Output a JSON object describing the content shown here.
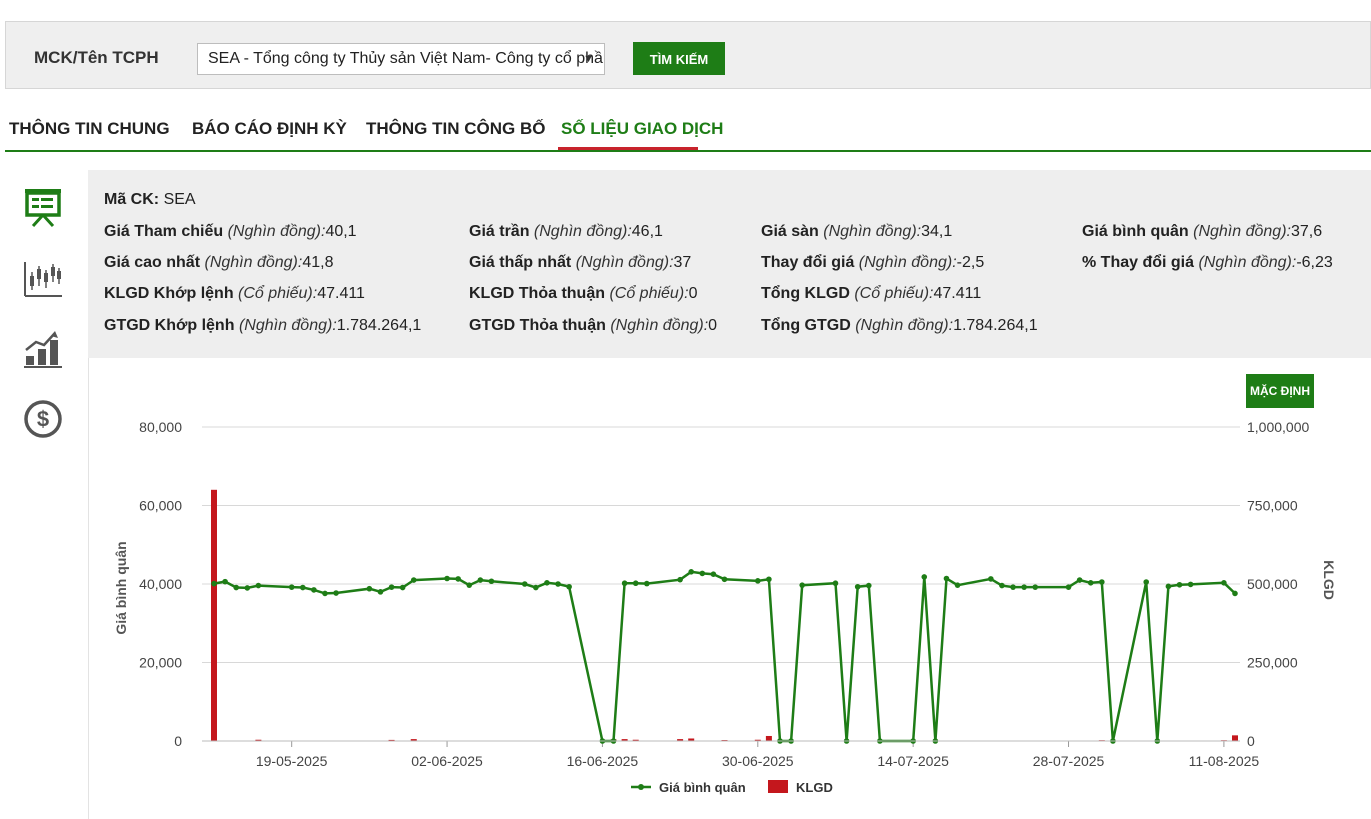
{
  "search": {
    "label": "MCK/Tên TCPH",
    "selected": "SEA - Tổng công ty Thủy sản Việt Nam- Công ty cổ phần",
    "button": "TÌM KIẾM"
  },
  "tabs": [
    {
      "label": "THÔNG TIN CHUNG"
    },
    {
      "label": "BÁO CÁO ĐỊNH KỲ"
    },
    {
      "label": "THÔNG TIN CÔNG BỐ"
    },
    {
      "label": "SỐ LIỆU GIAO DỊCH"
    }
  ],
  "sidebar": {
    "icons": [
      "presentation-icon",
      "candlestick-chart-icon",
      "growth-chart-icon",
      "dollar-coin-icon"
    ],
    "accent": "#1e7d16"
  },
  "info": {
    "ma_ck": {
      "label": "Mã CK:",
      "value": "SEA"
    },
    "fields": [
      {
        "label": "Giá Tham chiếu",
        "unit": "(Nghìn đồng):",
        "value": "40,1"
      },
      {
        "label": "Giá trần",
        "unit": "(Nghìn đồng):",
        "value": "46,1"
      },
      {
        "label": "Giá sàn",
        "unit": "(Nghìn đồng):",
        "value": "34,1"
      },
      {
        "label": "Giá bình quân",
        "unit": "(Nghìn đồng):",
        "value": "37,6"
      },
      {
        "label": "Giá cao nhất",
        "unit": "(Nghìn đồng):",
        "value": "41,8"
      },
      {
        "label": "Giá thấp nhất",
        "unit": "(Nghìn đồng):",
        "value": "37"
      },
      {
        "label": "Thay đổi giá",
        "unit": "(Nghìn đồng):",
        "value": "-2,5"
      },
      {
        "label": "% Thay đổi giá",
        "unit": "(Nghìn đồng):",
        "value": "-6,23"
      },
      {
        "label": "KLGD Khớp lệnh",
        "unit": "(Cổ phiếu):",
        "value": "47.411"
      },
      {
        "label": "KLGD Thỏa thuận",
        "unit": "(Cổ phiếu):",
        "value": "0"
      },
      {
        "label": "Tổng KLGD",
        "unit": "(Cổ phiếu):",
        "value": "47.411"
      },
      {
        "label": "GTGD Khớp lệnh",
        "unit": "(Nghìn đồng):",
        "value": "1.784.264,1"
      },
      {
        "label": "GTGD Thỏa thuận",
        "unit": "(Nghìn đồng):",
        "value": "0"
      },
      {
        "label": "Tổng GTGD",
        "unit": "(Nghìn đồng):",
        "value": "1.784.264,1"
      }
    ]
  },
  "chart_controls": {
    "default_button": "MẶC ĐỊNH"
  },
  "chart_data": {
    "type": "line+bar",
    "title": "",
    "ylabel": "Giá bình quân",
    "y2label": "KLGD",
    "ylim": [
      0,
      80000
    ],
    "y2lim": [
      0,
      1000000
    ],
    "yticks": [
      "0",
      "20,000",
      "40,000",
      "60,000",
      "80,000"
    ],
    "y2ticks": [
      "0",
      "250,000",
      "500,000",
      "750,000",
      "1,000,000"
    ],
    "xticks": [
      "19-05-2025",
      "02-06-2025",
      "16-06-2025",
      "30-06-2025",
      "14-07-2025",
      "28-07-2025",
      "11-08-2025"
    ],
    "legend": [
      "Giá bình quân",
      "KLGD"
    ],
    "legend_position": "bottom",
    "colors": {
      "line": "#1e7d16",
      "bar": "#c4171d",
      "grid": "#d8d8d8"
    },
    "grid": true,
    "series": [
      {
        "name": "Giá bình quân",
        "type": "line",
        "x": [
          "2025-05-12",
          "2025-05-13",
          "2025-05-14",
          "2025-05-15",
          "2025-05-16",
          "2025-05-19",
          "2025-05-20",
          "2025-05-21",
          "2025-05-22",
          "2025-05-23",
          "2025-05-26",
          "2025-05-27",
          "2025-05-28",
          "2025-05-29",
          "2025-05-30",
          "2025-06-02",
          "2025-06-03",
          "2025-06-04",
          "2025-06-05",
          "2025-06-06",
          "2025-06-09",
          "2025-06-10",
          "2025-06-11",
          "2025-06-12",
          "2025-06-13",
          "2025-06-16",
          "2025-06-17",
          "2025-06-18",
          "2025-06-19",
          "2025-06-20",
          "2025-06-23",
          "2025-06-24",
          "2025-06-25",
          "2025-06-26",
          "2025-06-27",
          "2025-06-30",
          "2025-07-01",
          "2025-07-02",
          "2025-07-03",
          "2025-07-04",
          "2025-07-07",
          "2025-07-08",
          "2025-07-09",
          "2025-07-10",
          "2025-07-11",
          "2025-07-14",
          "2025-07-15",
          "2025-07-16",
          "2025-07-17",
          "2025-07-18",
          "2025-07-21",
          "2025-07-22",
          "2025-07-23",
          "2025-07-24",
          "2025-07-25",
          "2025-07-28",
          "2025-07-29",
          "2025-07-30",
          "2025-07-31",
          "2025-08-01",
          "2025-08-04",
          "2025-08-05",
          "2025-08-06",
          "2025-08-07",
          "2025-08-08",
          "2025-08-11",
          "2025-08-12"
        ],
        "values": [
          40100,
          40600,
          39100,
          39000,
          39600,
          39200,
          39100,
          38500,
          37600,
          37700,
          38800,
          38000,
          39200,
          39100,
          41000,
          41400,
          41300,
          39700,
          41000,
          40700,
          40000,
          39100,
          40300,
          40000,
          39300,
          0,
          0,
          40200,
          40200,
          40100,
          41100,
          43100,
          42700,
          42500,
          41200,
          40800,
          41200,
          0,
          0,
          39700,
          40200,
          0,
          39300,
          39600,
          0,
          0,
          41800,
          0,
          41400,
          39700,
          41300,
          39600,
          39200,
          39200,
          39200,
          39200,
          41000,
          40300,
          40500,
          0,
          40500,
          0,
          39400,
          39800,
          39900,
          40300,
          37600
        ]
      },
      {
        "name": "KLGD",
        "type": "bar",
        "x": [
          "2025-05-12",
          "2025-05-16",
          "2025-05-28",
          "2025-05-30",
          "2025-06-17",
          "2025-06-18",
          "2025-06-19",
          "2025-06-23",
          "2025-06-24",
          "2025-06-27",
          "2025-06-30",
          "2025-07-01",
          "2025-07-31",
          "2025-08-11",
          "2025-08-12"
        ],
        "values": [
          800000,
          4000,
          3500,
          6000,
          5000,
          6000,
          4000,
          6000,
          8000,
          3000,
          4000,
          16000,
          2500,
          2500,
          18000
        ]
      }
    ]
  }
}
